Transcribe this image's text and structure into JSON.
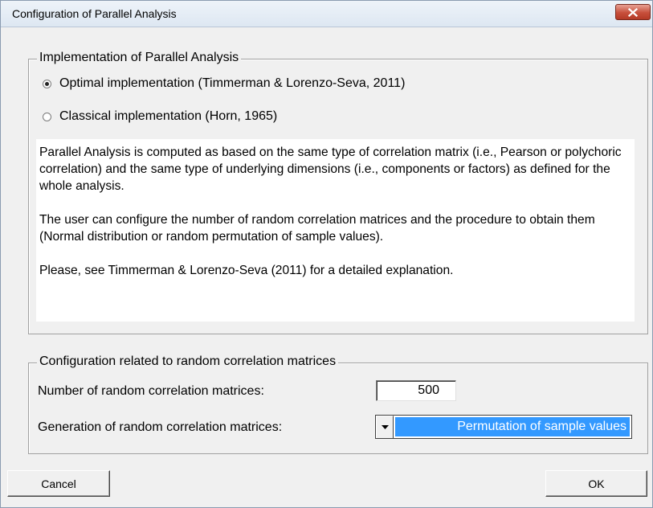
{
  "window": {
    "title": "Configuration of Parallel Analysis"
  },
  "implementation": {
    "legend": "Implementation of Parallel Analysis",
    "options": [
      {
        "label": "Optimal implementation (Timmerman & Lorenzo-Seva, 2011)",
        "selected": true
      },
      {
        "label": "Classical implementation (Horn, 1965)",
        "selected": false
      }
    ],
    "description": [
      "Parallel Analysis is computed as based on the same type of correlation matrix (i.e., Pearson or polychoric correlation) and the same type of underlying dimensions (i.e., components or factors) as defined for the whole analysis.",
      "The user can configure the number of random correlation matrices and the procedure to obtain them (Normal distribution or random permutation of sample values).",
      "Please, see Timmerman & Lorenzo-Seva (2011) for a detailed explanation."
    ]
  },
  "random_config": {
    "legend": "Configuration related to random correlation matrices",
    "number_label": "Number of random correlation matrices:",
    "number_value": "500",
    "generation_label": "Generation of random correlation matrices:",
    "generation_value": "Permutation of sample values"
  },
  "buttons": {
    "cancel": "Cancel",
    "ok": "OK"
  },
  "colors": {
    "selection": "#3399ff",
    "close_button": "#c74f3b",
    "dialog_bg": "#f0f0f0"
  },
  "icons": {
    "close": "close-icon",
    "dropdown": "chevron-down-icon"
  }
}
